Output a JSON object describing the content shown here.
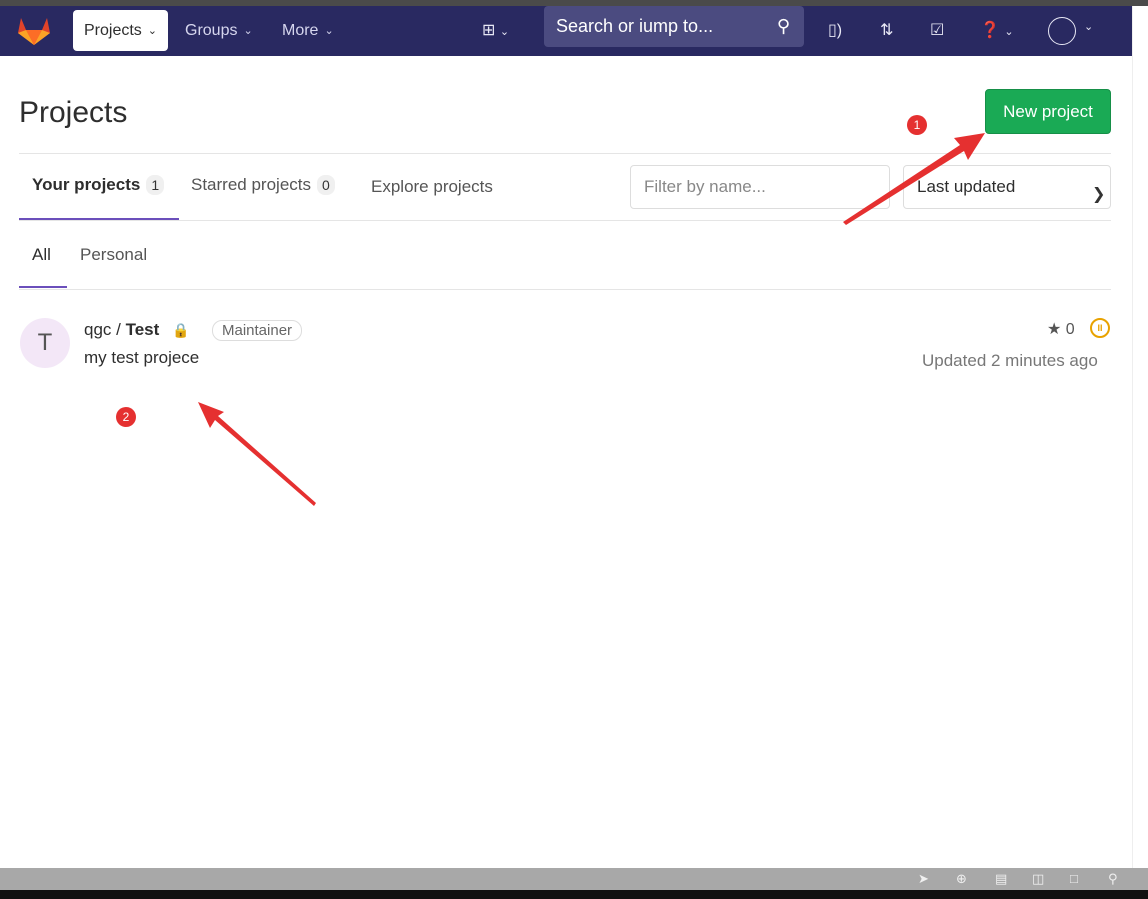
{
  "navbar": {
    "items": [
      {
        "label": "Projects",
        "active": true
      },
      {
        "label": "Groups"
      },
      {
        "label": "More"
      }
    ],
    "search_placeholder": "Search or iump to...",
    "icons": [
      "plus-square-icon",
      "issues-icon",
      "merge-request-icon",
      "todo-icon",
      "help-icon",
      "user-avatar"
    ]
  },
  "page": {
    "title": "Projects",
    "new_project_label": "New project",
    "tabs": [
      {
        "label": "Your projects",
        "count": "1",
        "active": true
      },
      {
        "label": "Starred projects",
        "count": "0"
      },
      {
        "label": "Explore projects"
      }
    ],
    "filter_placeholder": "Filter by name...",
    "sort_value": "Last updated",
    "subtabs": [
      {
        "label": "All",
        "active": true
      },
      {
        "label": "Personal"
      }
    ]
  },
  "projects": [
    {
      "avatar_letter": "T",
      "namespace": "qgc / ",
      "name": "Test",
      "visibility": "private",
      "role": "Maintainer",
      "description": "my test projece",
      "stars": "0",
      "pipeline_status": "paused",
      "updated": "Updated 2 minutes ago"
    }
  ],
  "annotations": {
    "one": "1",
    "two": "2",
    "color": "#e53030"
  },
  "colors": {
    "navbar": "#292961",
    "accent": "#6b4fbb",
    "success": "#1aaa55"
  }
}
